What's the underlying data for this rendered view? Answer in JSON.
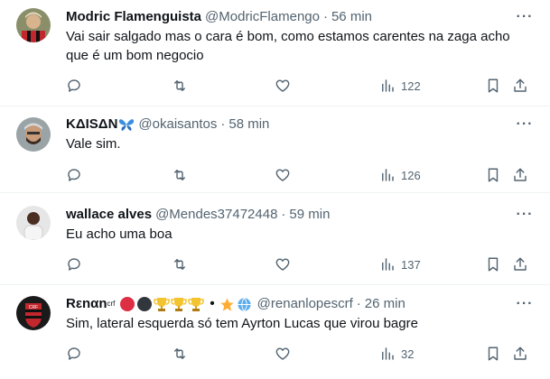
{
  "tweets": [
    {
      "name": "Modric Flamenguista",
      "handle": "@ModricFlamengo",
      "sep": "·",
      "time": "56 min",
      "text": "Vai sair salgado mas o cara é bom, como estamos carentes na zaga acho que é um bom negocio",
      "views": "122"
    },
    {
      "name": "ΚΔΙSΔN",
      "handle": "@okaisantos",
      "sep": "·",
      "time": "58 min",
      "text": "Vale sim.",
      "views": "126",
      "name_emoji": "butterfly"
    },
    {
      "name": "wallace alves",
      "handle": "@Mendes37472448",
      "sep": "·",
      "time": "59 min",
      "text": "Eu acho uma boa",
      "views": "137"
    },
    {
      "name": "Rεnαn",
      "name_sup": "crf",
      "handle": "@renanlopescrf",
      "sep": "·",
      "time": "26 min",
      "text": "Sim, lateral esquerda só tem Ayrton Lucas que virou bagre",
      "views": "32",
      "name_emoji": "red-circle, black-circle, trophy, trophy, trophy, bullet, star, globe"
    }
  ],
  "colors": {
    "secondary_text": "#536471",
    "divider": "#eff3f4",
    "text": "#0f1419"
  }
}
